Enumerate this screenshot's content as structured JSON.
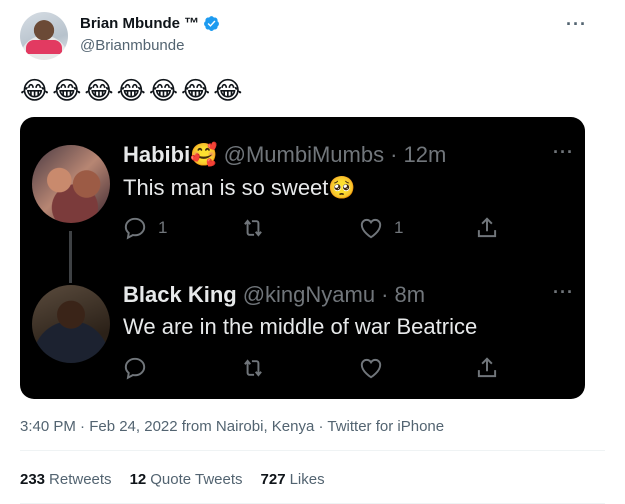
{
  "author": {
    "name": "Brian Mbunde ™",
    "handle": "@Brianmbunde",
    "more": "···"
  },
  "tweet": {
    "text": "😂😂😂😂😂😂😂"
  },
  "embedded": [
    {
      "name": "Habibi🥰",
      "handle": "@MumbiMumbs",
      "time": "· 12m",
      "text": "This man is so sweet🥺",
      "reply_count": "1",
      "like_count": "1",
      "more": "···"
    },
    {
      "name": "Black King",
      "handle": "@kingNyamu",
      "time": "· 8m",
      "text": "We are in the middle of war Beatrice",
      "reply_count": "",
      "like_count": "",
      "more": "···"
    }
  ],
  "meta": {
    "timestamp": "3:40 PM · Feb 24, 2022 from Nairobi, Kenya · Twitter for iPhone"
  },
  "stats": {
    "retweets_count": "233",
    "retweets_label": "Retweets",
    "quotes_count": "12",
    "quotes_label": "Quote Tweets",
    "likes_count": "727",
    "likes_label": "Likes"
  },
  "colors": {
    "verified": "#1d9bf0",
    "embed_bg": "#000000",
    "muted": "#71767b"
  }
}
